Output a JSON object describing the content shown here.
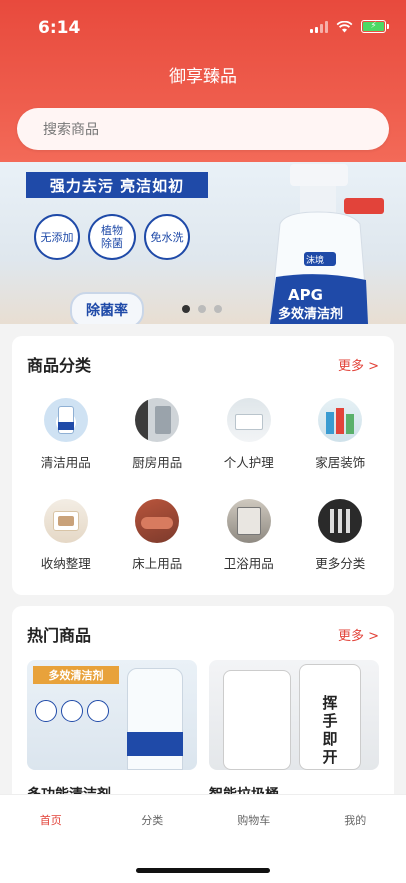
{
  "status": {
    "time": "6:14",
    "battery_icon": "battery-charging-icon",
    "wifi_icon": "wifi-icon",
    "signal_icon": "cellular-signal-icon"
  },
  "header": {
    "title": "御享臻品"
  },
  "search": {
    "placeholder": "搜索商品"
  },
  "banner": {
    "slogan": "强力去污 亮洁如初",
    "badges": [
      "无添加",
      "植物除菌",
      "免水洗"
    ],
    "tag": "除菌率",
    "product_text": "APG 多效清洁剂",
    "pager": {
      "count": 3,
      "active": 0
    }
  },
  "categories": {
    "title": "商品分类",
    "more": "更多 >",
    "items": [
      {
        "label": "清洁用品",
        "icon": "cleaning-products-icon"
      },
      {
        "label": "厨房用品",
        "icon": "kitchen-products-icon"
      },
      {
        "label": "个人护理",
        "icon": "personal-care-icon"
      },
      {
        "label": "家居装饰",
        "icon": "home-decor-icon"
      },
      {
        "label": "收纳整理",
        "icon": "storage-icon"
      },
      {
        "label": "床上用品",
        "icon": "bedding-icon"
      },
      {
        "label": "卫浴用品",
        "icon": "bathroom-icon"
      },
      {
        "label": "更多分类",
        "icon": "more-categories-icon"
      }
    ]
  },
  "hot": {
    "title": "热门商品",
    "more": "更多 >",
    "products": [
      {
        "name": "多功能清洁剂",
        "image_text": "多效清洁剂"
      },
      {
        "name": "智能垃圾桶",
        "image_text": "挥手即开"
      }
    ]
  },
  "tabbar": {
    "tabs": [
      "首页",
      "分类",
      "购物车",
      "我的"
    ],
    "active_index": 0
  },
  "colors": {
    "primary": "#e84a3d",
    "accent_text": "#e2433a",
    "banner_blue": "#1f4aa8"
  }
}
